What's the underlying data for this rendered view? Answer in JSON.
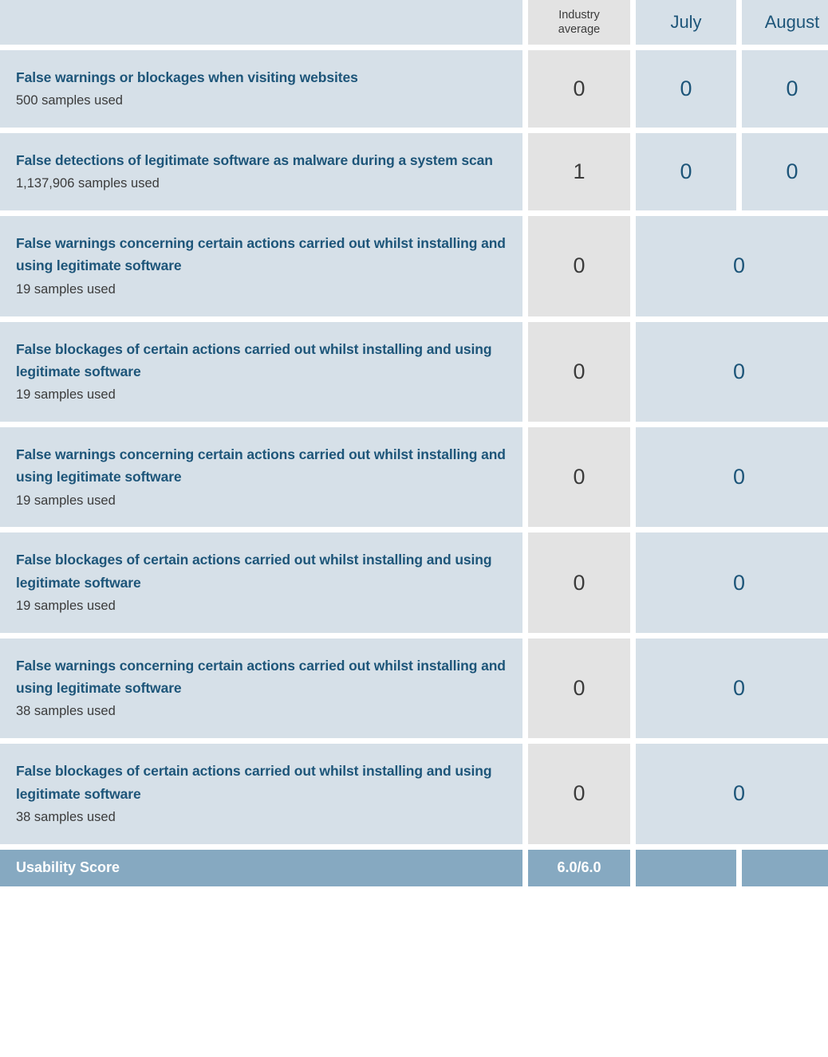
{
  "table": {
    "columns": {
      "description_header": "",
      "industry_average": "Industry average",
      "industry_average_line1": "Industry",
      "industry_average_line2": "average",
      "july": "July",
      "august": "August"
    },
    "rows": [
      {
        "title": "False warnings or blockages when visiting websites",
        "samples": "500 samples used",
        "industry_average": "0",
        "july": "0",
        "august": "0",
        "merged_months": false
      },
      {
        "title": "False detections of legitimate software as malware during a system scan",
        "samples": "1,137,906 samples used",
        "industry_average": "1",
        "july": "0",
        "august": "0",
        "merged_months": false
      },
      {
        "title": "False warnings concerning certain actions carried out whilst installing and using legitimate software",
        "samples": "19 samples used",
        "industry_average": "0",
        "months_value": "0",
        "merged_months": true
      },
      {
        "title": "False blockages of certain actions carried out whilst installing and using legitimate software",
        "samples": "19 samples used",
        "industry_average": "0",
        "months_value": "0",
        "merged_months": true
      },
      {
        "title": "False warnings concerning certain actions carried out whilst installing and using legitimate software",
        "samples": "19 samples used",
        "industry_average": "0",
        "months_value": "0",
        "merged_months": true
      },
      {
        "title": "False blockages of certain actions carried out whilst installing and using legitimate software",
        "samples": "19 samples used",
        "industry_average": "0",
        "months_value": "0",
        "merged_months": true
      },
      {
        "title": "False warnings concerning certain actions carried out whilst installing and using legitimate software",
        "samples": "38 samples used",
        "industry_average": "0",
        "months_value": "0",
        "merged_months": true
      },
      {
        "title": "False blockages of certain actions carried out whilst installing and using legitimate software",
        "samples": "38 samples used",
        "industry_average": "0",
        "months_value": "0",
        "merged_months": true
      }
    ],
    "footer": {
      "label": "Usability Score",
      "score": "6.0/6.0"
    }
  },
  "colors": {
    "cell_blue": "#d6e0e8",
    "cell_gray": "#e3e3e3",
    "text_blue": "#1d5579",
    "text_dark": "#3b3b3b",
    "footer_blue": "#86a9c1",
    "footer_text": "#ffffff"
  }
}
